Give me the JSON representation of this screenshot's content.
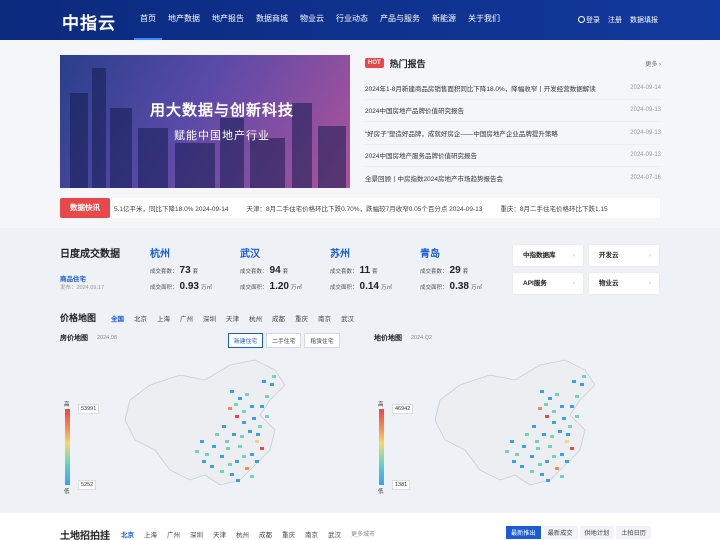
{
  "nav": {
    "logo": "中指云",
    "items": [
      "首页",
      "地产数据",
      "地产报告",
      "数据商城",
      "物业云",
      "行业动态",
      "产品与服务",
      "新能源",
      "关于我们"
    ],
    "login": "登录",
    "register": "注册",
    "data_fill": "数据填报"
  },
  "banner": {
    "title": "用大数据与创新科技",
    "subtitle": "赋能中国地产行业"
  },
  "hot": {
    "tag": "HOT",
    "title": "热门报告",
    "more": "更多",
    "items": [
      {
        "title": "2024年1-8月新建商品房销售面积同比下降18.0%，降幅收窄丨开发经营数据解读",
        "date": "2024-09-14"
      },
      {
        "title": "2024中国房地产品牌价值研究报告",
        "date": "2024-09-13"
      },
      {
        "title": "“好房子”塑造好品牌，成就好房企——中国房地产企业品牌提升策略",
        "date": "2024-09-13"
      },
      {
        "title": "2024中国房地产服务品牌价值研究报告",
        "date": "2024-09-13"
      },
      {
        "title": "全景回顾丨中房指数2024房地产市场趋势报告会",
        "date": "2024-07-16"
      }
    ]
  },
  "ticker": {
    "tag": "数据快讯",
    "items": [
      "5.1亿平米，同比下降18.0% 2024-09-14",
      "天津：8月二手住宅价格环比下跌0.70%，跌幅较7月收窄0.05个百分点 2024-09-13",
      "重庆：8月二手住宅价格环比下跌1.15"
    ]
  },
  "daily": {
    "title": "日度成交数据",
    "type": "商品住宅",
    "date": "发布：2024.09.17",
    "count_label": "成交套数：",
    "area_label": "成交面积：",
    "count_unit": "套",
    "area_unit": "万㎡",
    "cities": [
      {
        "name": "杭州",
        "count": "73",
        "area": "0.93"
      },
      {
        "name": "武汉",
        "count": "94",
        "area": "1.20"
      },
      {
        "name": "苏州",
        "count": "11",
        "area": "0.14"
      },
      {
        "name": "青岛",
        "count": "29",
        "area": "0.38"
      }
    ]
  },
  "quick": [
    "中指数据库",
    "开发云",
    "API服务",
    "物业云"
  ],
  "price_map": {
    "title": "价格地图",
    "cities": [
      "全国",
      "北京",
      "上海",
      "广州",
      "深圳",
      "天津",
      "杭州",
      "成都",
      "重庆",
      "南京",
      "武汉"
    ],
    "house": {
      "title": "房价地图",
      "date": "2024.08",
      "max": "53991",
      "min": "5252",
      "high": "高",
      "low": "低"
    },
    "land": {
      "title": "地价地图",
      "date": "2024.Q2",
      "max": "46942",
      "min": "1381",
      "high": "高",
      "low": "低"
    },
    "tabs": [
      "新建住宅",
      "二手住宅",
      "租赁住宅"
    ]
  },
  "land": {
    "title": "土地招拍挂",
    "cities": [
      "北京",
      "上海",
      "广州",
      "深圳",
      "天津",
      "杭州",
      "成都",
      "重庆",
      "南京",
      "武汉"
    ],
    "more": "更多城市",
    "tabs": [
      "最新推出",
      "最新成交",
      "供地计划",
      "土拍日历"
    ]
  }
}
